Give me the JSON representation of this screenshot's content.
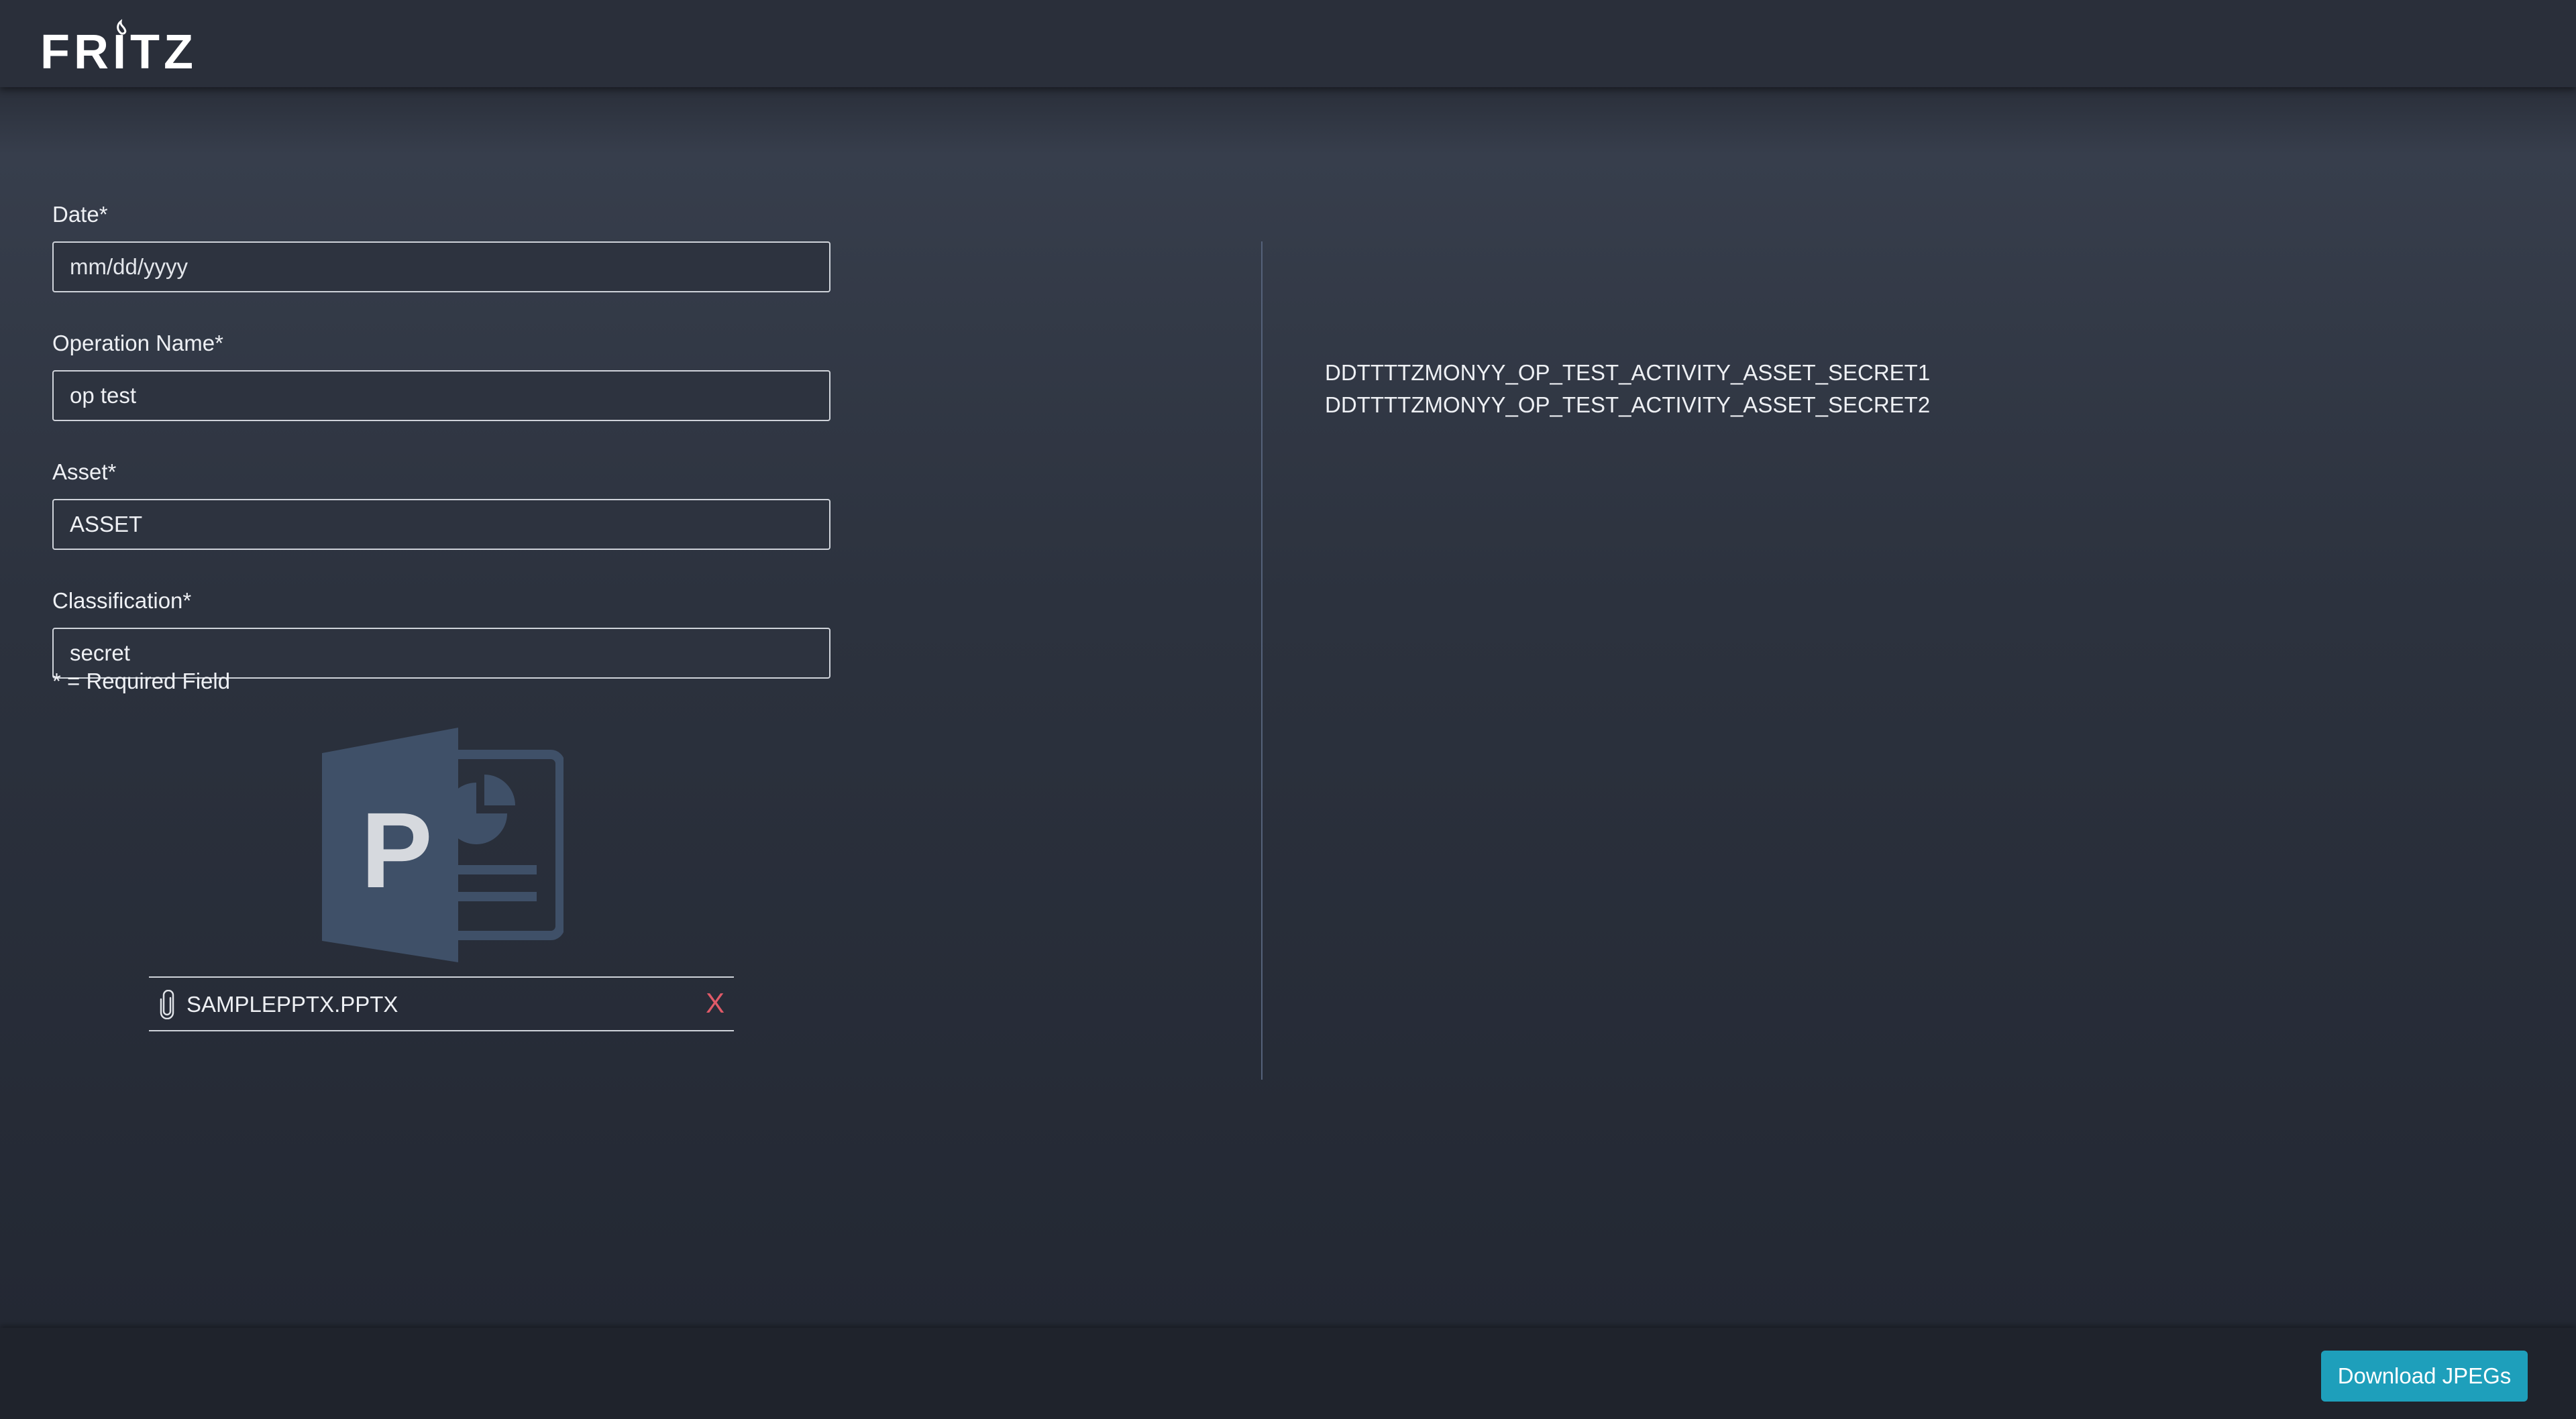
{
  "app": {
    "logo_text": "FRITZ"
  },
  "form": {
    "fields": [
      {
        "label": "Date*",
        "value": "",
        "placeholder": "mm/dd/yyyy"
      },
      {
        "label": "Operation Name*",
        "value": "op test",
        "placeholder": ""
      },
      {
        "label": "Asset*",
        "value": "ASSET",
        "placeholder": ""
      },
      {
        "label": "Classification*",
        "value": "secret",
        "placeholder": ""
      }
    ],
    "required_note": "* = Required Field"
  },
  "upload": {
    "icon": "powerpoint-file-icon",
    "file_icon": "paperclip-icon",
    "file_name": "SAMPLEPPTX.PPTX",
    "remove_label": "X"
  },
  "output": {
    "lines": [
      "DDTTTTZMONYY_OP_TEST_ACTIVITY_ASSET_SECRET1",
      "DDTTTTZMONYY_OP_TEST_ACTIVITY_ASSET_SECRET2"
    ]
  },
  "footer": {
    "download_label": "Download JPEGs"
  },
  "colors": {
    "accent": "#1e9fbb",
    "remove": "#e05a68",
    "icon": "#3f5068"
  }
}
